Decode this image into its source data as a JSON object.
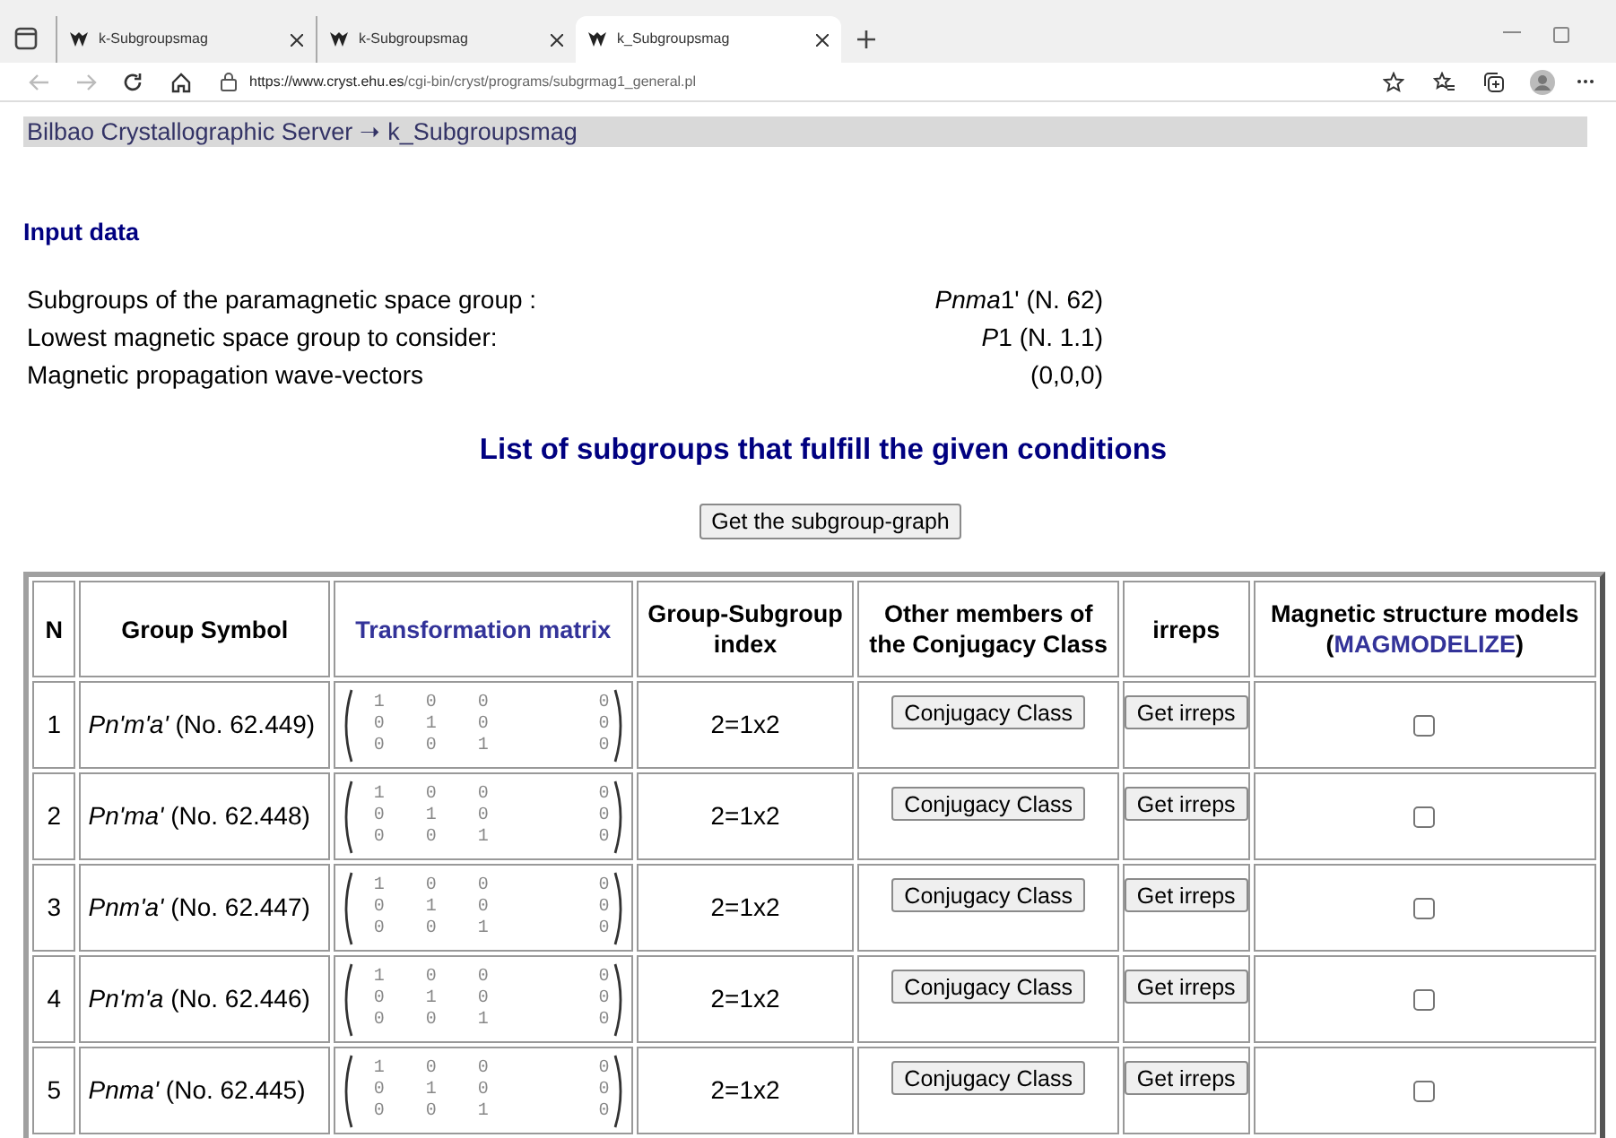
{
  "browser": {
    "tabs": [
      {
        "title": "k-Subgroupsmag",
        "selected": false
      },
      {
        "title": "k-Subgroupsmag",
        "selected": false
      },
      {
        "title": "k_Subgroupsmag",
        "selected": true
      }
    ],
    "url_host": "https://www.cryst.ehu.es",
    "url_path": "/cgi-bin/cryst/programs/subgrmag1_general.pl"
  },
  "breadcrumb": "Bilbao Crystallographic Server ➝ k_Subgroupsmag",
  "input_data": {
    "heading": "Input data",
    "rows": [
      {
        "label": "Subgroups of the paramagnetic space group :",
        "symbol": "Pnma",
        "value": "1' (N. 62)"
      },
      {
        "label": "Lowest magnetic space group to consider:",
        "symbol": "P",
        "value": "1 (N. 1.1)"
      },
      {
        "label": "Magnetic propagation wave-vectors",
        "value": "(0,0,0)"
      }
    ]
  },
  "list_title": "List of subgroups that fulfill the given conditions",
  "graph_button": "Get the subgroup-graph",
  "table": {
    "columns": [
      {
        "label": "N"
      },
      {
        "label": "Group Symbol"
      },
      {
        "label": "Transformation matrix",
        "kind": "link"
      },
      {
        "label": "Group-Subgroup index"
      },
      {
        "label": "Other members of the Conjugacy Class"
      },
      {
        "label": "irreps"
      },
      {
        "label": "Magnetic structure models",
        "open": "(",
        "link": "MAGMODELIZE",
        "close": ")"
      }
    ],
    "rows": [
      {
        "n": "1",
        "symbol": "*Pn'm'a'* (No. 62.449)",
        "matrix": [
          [
            "1",
            "0",
            "0",
            "0"
          ],
          [
            "0",
            "1",
            "0",
            "0"
          ],
          [
            "0",
            "0",
            "1",
            "0"
          ]
        ],
        "index": "2=1x2",
        "conjugacy_button": "Conjugacy Class",
        "irreps_button": "Get irreps",
        "checked": false
      },
      {
        "n": "2",
        "symbol": "*Pn'ma'* (No. 62.448)",
        "matrix": [
          [
            "1",
            "0",
            "0",
            "0"
          ],
          [
            "0",
            "1",
            "0",
            "0"
          ],
          [
            "0",
            "0",
            "1",
            "0"
          ]
        ],
        "index": "2=1x2",
        "conjugacy_button": "Conjugacy Class",
        "irreps_button": "Get irreps",
        "checked": false
      },
      {
        "n": "3",
        "symbol": "*Pnm'a'* (No. 62.447)",
        "matrix": [
          [
            "1",
            "0",
            "0",
            "0"
          ],
          [
            "0",
            "1",
            "0",
            "0"
          ],
          [
            "0",
            "0",
            "1",
            "0"
          ]
        ],
        "index": "2=1x2",
        "conjugacy_button": "Conjugacy Class",
        "irreps_button": "Get irreps",
        "checked": false
      },
      {
        "n": "4",
        "symbol": "*Pn'm'a* (No. 62.446)",
        "matrix": [
          [
            "1",
            "0",
            "0",
            "0"
          ],
          [
            "0",
            "1",
            "0",
            "0"
          ],
          [
            "0",
            "0",
            "1",
            "0"
          ]
        ],
        "index": "2=1x2",
        "conjugacy_button": "Conjugacy Class",
        "irreps_button": "Get irreps",
        "checked": false
      },
      {
        "n": "5",
        "symbol": "*Pnma'* (No. 62.445)",
        "matrix": [
          [
            "1",
            "0",
            "0",
            "0"
          ],
          [
            "0",
            "1",
            "0",
            "0"
          ],
          [
            "0",
            "0",
            "1",
            "0"
          ]
        ],
        "index": "2=1x2",
        "conjugacy_button": "Conjugacy Class",
        "irreps_button": "Get irreps",
        "checked": false
      }
    ]
  }
}
